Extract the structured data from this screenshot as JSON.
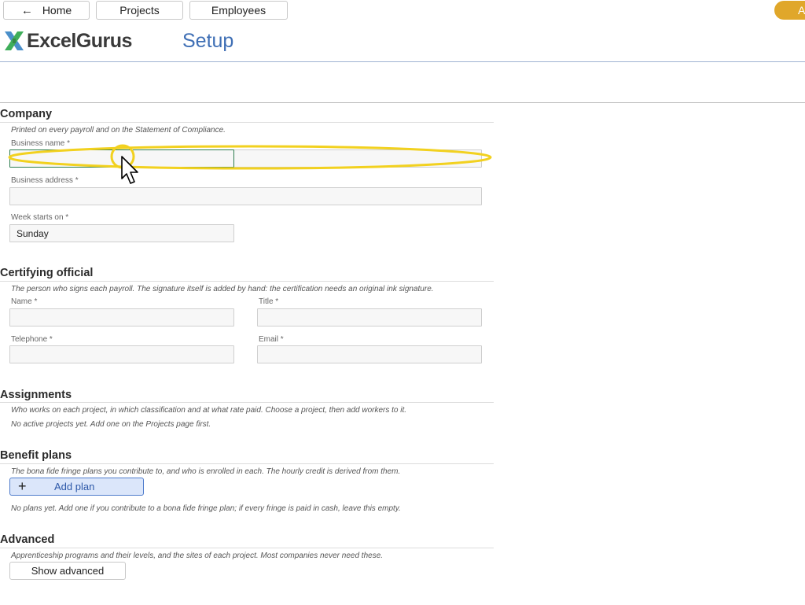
{
  "nav": {
    "home_label": "Home",
    "projects_label": "Projects",
    "employees_label": "Employees",
    "account_initial": "A"
  },
  "brand": {
    "logo_text": "ExcelGurus"
  },
  "page": {
    "title": "Setup"
  },
  "company": {
    "heading": "Company",
    "description": "Printed on every payroll and on the Statement of Compliance.",
    "business_name_label": "Business name *",
    "business_name_value": "",
    "business_address_label": "Business address *",
    "business_address_value": "",
    "week_starts_label": "Week starts on *",
    "week_starts_value": "Sunday"
  },
  "certifying": {
    "heading": "Certifying official",
    "description": "The person who signs each payroll. The signature itself is added by hand: the certification needs an original ink signature.",
    "name_label": "Name *",
    "title_label": "Title *",
    "telephone_label": "Telephone *",
    "email_label": "Email *"
  },
  "assignments": {
    "heading": "Assignments",
    "description": "Who works on each project, in which classification and at what rate paid. Choose a project, then add workers to it.",
    "empty_text": "No active projects yet. Add one on the Projects page first."
  },
  "benefits": {
    "heading": "Benefit plans",
    "description": "The bona fide fringe plans you contribute to, and who is enrolled in each. The hourly credit is derived from them.",
    "add_plan_label": "Add plan",
    "plus_glyph": "+",
    "empty_text": "No plans yet. Add one if you contribute to a bona fide fringe plan; if every fringe is paid in cash, leave this empty."
  },
  "advanced": {
    "heading": "Advanced",
    "description": "Apprenticeship programs and their levels, and the sites of each project. Most companies never need these.",
    "show_label": "Show advanced"
  },
  "colors": {
    "accent": "#3f6fb5",
    "account_pill": "#e0a72a",
    "highlight": "#f2d11f",
    "focus_border": "#2e7d4f",
    "primary_button_bg": "#dbe6fa"
  },
  "icons": {
    "back": "left-arrow-icon",
    "logo_mark": "x-logo-icon",
    "plus": "plus-icon",
    "cursor": "mouse-pointer-icon"
  }
}
